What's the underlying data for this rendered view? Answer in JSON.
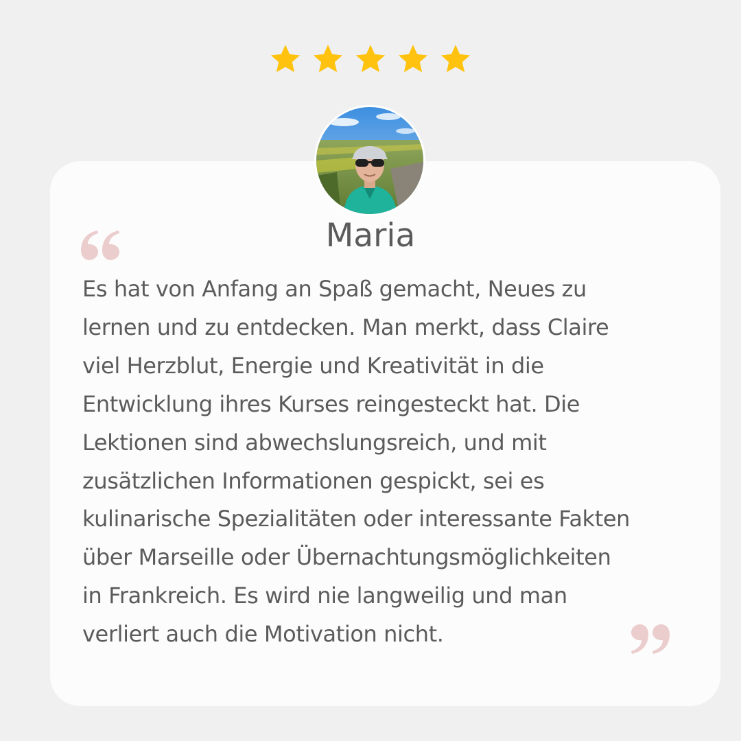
{
  "rating": {
    "value": 5,
    "max": 5,
    "icon": "star-icon",
    "color": "#ffc20e"
  },
  "reviewer": {
    "name": "Maria",
    "avatar": "reviewer-avatar-photo"
  },
  "quote_icons": {
    "open": "open-quote-icon",
    "close": "close-quote-icon",
    "color": "#ebcdcd"
  },
  "review": {
    "lines": [
      "Es hat von Anfang an Spaß gemacht, Neues zu",
      "lernen und zu entdecken. Man merkt, dass Claire",
      "viel Herzblut, Energie und Kreativität in die",
      "Entwicklung ihres Kurses reingesteckt hat. Die",
      "Lektionen sind abwechslungsreich, und mit",
      "zusätzlichen Informationen gespickt, sei es",
      "kulinarische Spezialitäten oder interessante Fakten",
      "über Marseille oder Übernachtungsmöglichkeiten",
      "in Frankreich. Es wird nie langweilig und man",
      "verliert auch die Motivation nicht."
    ]
  },
  "colors": {
    "background": "#f0f0f0",
    "card": "#fcfcfc",
    "text": "#5b5b5b",
    "star": "#ffc20e",
    "quote": "#ebcdcd"
  }
}
